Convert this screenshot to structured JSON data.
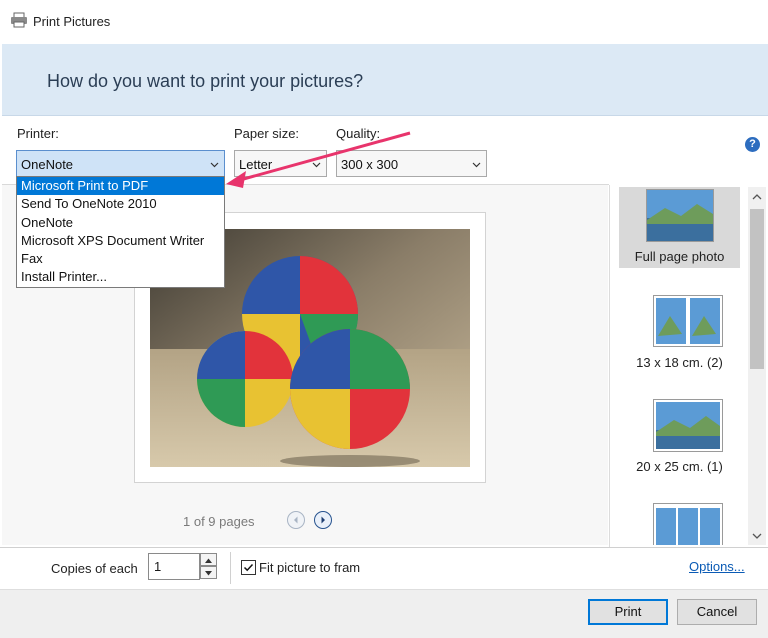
{
  "window": {
    "title": "Print Pictures",
    "icon": "printer-icon"
  },
  "header": {
    "question": "How do you want to print your pictures?"
  },
  "printer": {
    "label": "Printer:",
    "value": "OneNote",
    "options": [
      "Microsoft Print to PDF",
      "Send To OneNote 2010",
      "OneNote",
      "Microsoft XPS Document Writer",
      "Fax",
      "Install Printer..."
    ],
    "highlighted_index": 0
  },
  "paper_size": {
    "label": "Paper size:",
    "value": "Letter"
  },
  "quality": {
    "label": "Quality:",
    "value": "300 x 300"
  },
  "help": {
    "glyph": "?"
  },
  "preview": {
    "pages_text": "1 of 9 pages"
  },
  "thumbnails": [
    {
      "label": "Full page photo",
      "selected": true
    },
    {
      "label": "13 x 18 cm. (2)",
      "selected": false
    },
    {
      "label": "20 x 25 cm. (1)",
      "selected": false
    },
    {
      "label": "",
      "selected": false
    }
  ],
  "copies": {
    "label": "Copies of each",
    "value": "1"
  },
  "fit_picture": {
    "label": "Fit picture to fram",
    "checked": true
  },
  "options_link": "Options...",
  "buttons": {
    "print": "Print",
    "cancel": "Cancel"
  },
  "colors": {
    "accent": "#0078d7",
    "header_band": "#dce9f5",
    "annotation_arrow": "#e8346c"
  }
}
